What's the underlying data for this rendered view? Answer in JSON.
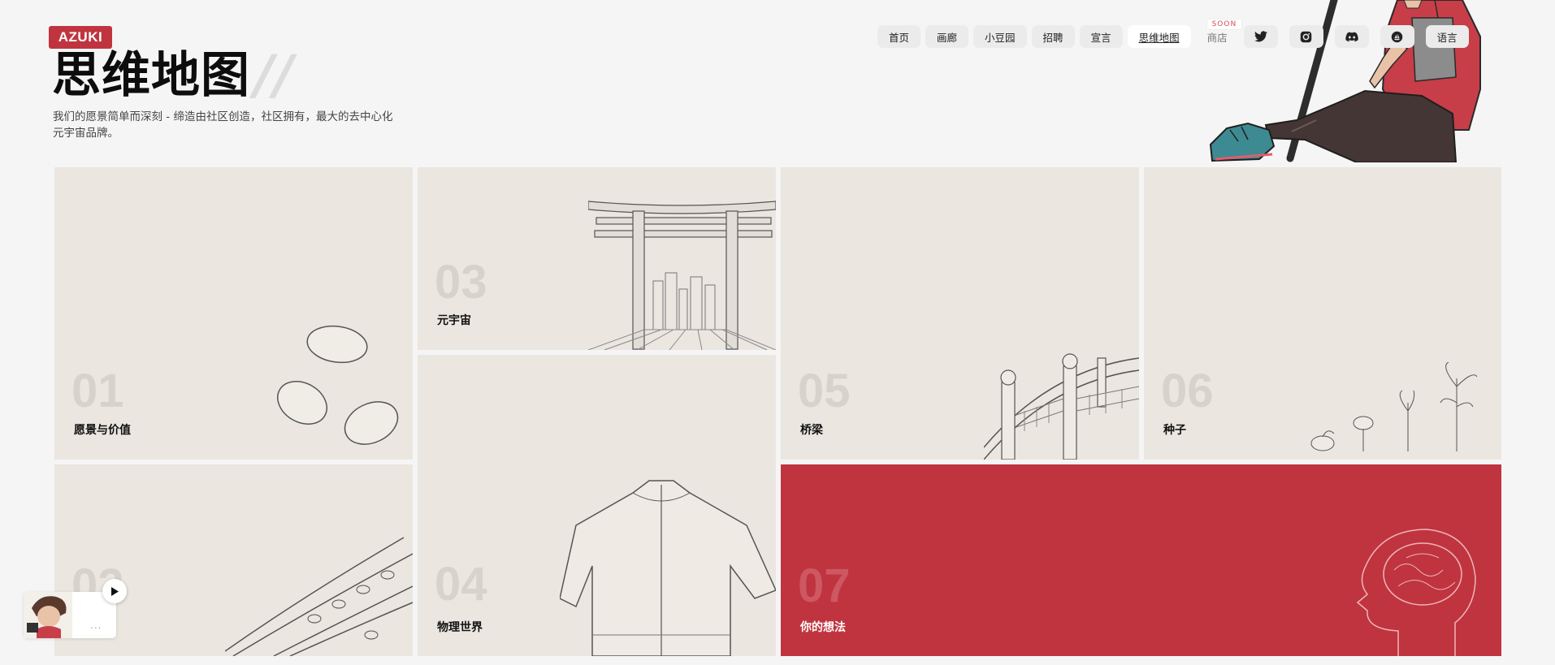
{
  "brand": {
    "logo_text": "AZUKI",
    "accent": "#c0343f"
  },
  "header": {
    "title": "思维地图",
    "slashes": "//",
    "description": "我们的愿景简单而深刻  -  缔造由社区创造，社区拥有，最大的去中心化元宇宙品牌。"
  },
  "nav": {
    "items": [
      {
        "label": "首页"
      },
      {
        "label": "画廊"
      },
      {
        "label": "小豆园"
      },
      {
        "label": "招聘"
      },
      {
        "label": "宣言"
      },
      {
        "label": "思维地图",
        "active": true
      }
    ],
    "shop": {
      "label": "商店",
      "badge": "SOON"
    },
    "icons": [
      "twitter-icon",
      "instagram-icon",
      "discord-icon",
      "opensea-icon"
    ],
    "language_label": "语言"
  },
  "cards": [
    {
      "num": "01",
      "label": "愿景与价值"
    },
    {
      "num": "02",
      "label": ""
    },
    {
      "num": "03",
      "label": "元宇宙"
    },
    {
      "num": "04",
      "label": "物理世界"
    },
    {
      "num": "05",
      "label": "桥梁"
    },
    {
      "num": "06",
      "label": "种子"
    },
    {
      "num": "07",
      "label": "你的想法"
    }
  ],
  "player": {
    "dots": "..."
  }
}
